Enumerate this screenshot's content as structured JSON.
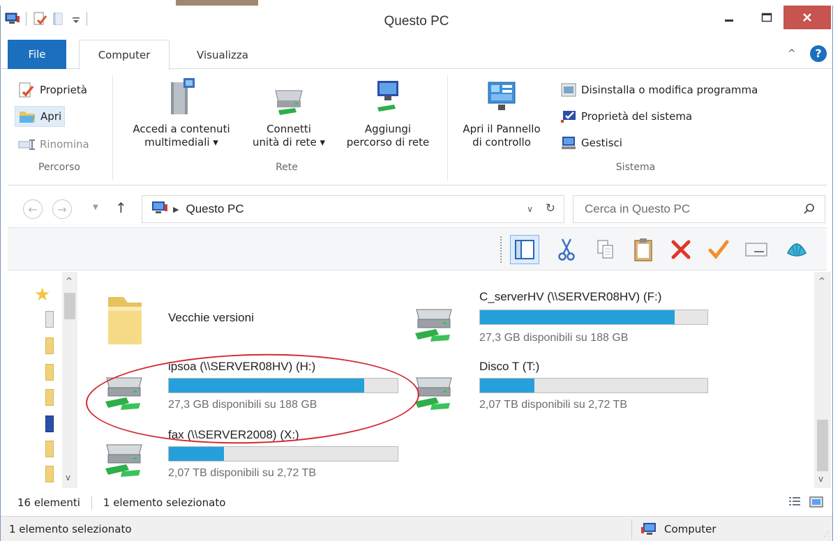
{
  "window": {
    "title": "Questo PC"
  },
  "ribbon": {
    "tabs": [
      {
        "label": "File"
      },
      {
        "label": "Computer"
      },
      {
        "label": "Visualizza"
      }
    ],
    "groups": {
      "percorso": {
        "label": "Percorso",
        "items": [
          {
            "label": "Proprietà"
          },
          {
            "label": "Apri"
          },
          {
            "label": "Rinomina"
          }
        ]
      },
      "rete": {
        "label": "Rete",
        "items": [
          {
            "line1": "Accedi a contenuti",
            "line2": "multimediali ▾"
          },
          {
            "line1": "Connetti",
            "line2": "unità di rete ▾"
          },
          {
            "line1": "Aggiungi",
            "line2": "percorso di rete"
          }
        ]
      },
      "sistema": {
        "label": "Sistema",
        "big": {
          "line1": "Apri il Pannello",
          "line2": "di controllo"
        },
        "items": [
          {
            "label": "Disinstalla o modifica programma"
          },
          {
            "label": "Proprietà del sistema"
          },
          {
            "label": "Gestisci"
          }
        ]
      }
    }
  },
  "address": {
    "path": "Questo PC",
    "search_placeholder": "Cerca in Questo PC"
  },
  "items": [
    {
      "name": "Vecchie versioni",
      "type": "folder"
    },
    {
      "name": "C_serverHV (\\\\SERVER08HV) (F:)",
      "type": "drive",
      "free_text": "27,3 GB disponibili su 188 GB",
      "used_fraction": 0.855
    },
    {
      "name": "ipsoa (\\\\SERVER08HV) (H:)",
      "type": "drive",
      "free_text": "27,3 GB disponibili su 188 GB",
      "used_fraction": 0.855
    },
    {
      "name": "Disco T (T:)",
      "type": "drive",
      "free_text": "2,07 TB disponibili su 2,72 TB",
      "used_fraction": 0.24
    },
    {
      "name": "fax (\\\\SERVER2008) (X:)",
      "type": "drive",
      "free_text": "2,07 TB disponibili su 2,72 TB",
      "used_fraction": 0.24
    }
  ],
  "status": {
    "count": "16 elementi",
    "selected": "1 elemento selezionato",
    "bottom_message": "1 elemento selezionato",
    "zone": "Computer"
  },
  "colors": {
    "accent": "#1b6fbe",
    "progress": "#26a0da",
    "close": "#c7544e",
    "annotation": "#d2282e"
  }
}
